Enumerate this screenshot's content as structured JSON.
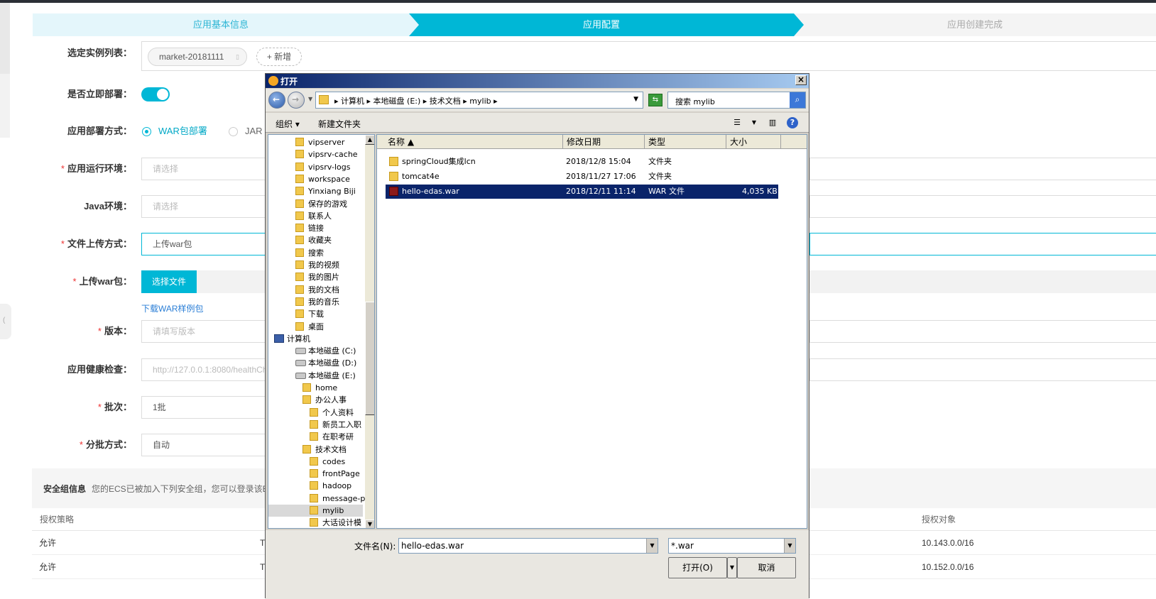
{
  "steps": [
    "应用基本信息",
    "应用配置",
    "应用创建完成"
  ],
  "form": {
    "instance_label": "选定实例列表：",
    "instance_tag": "market-20181111",
    "add_label": "+ 新增",
    "deploy_now_label": "是否立即部署：",
    "deploy_mode_label": "应用部署方式：",
    "deploy_war": "WAR包部署",
    "deploy_jar": "JAR",
    "runtime_label": "应用运行环境：",
    "runtime_placeholder": "请选择",
    "java_label": "Java环境：",
    "java_placeholder": "请选择",
    "upload_mode_label": "文件上传方式：",
    "upload_mode_value": "上传war包",
    "upload_war_label": "上传war包：",
    "choose_file": "选择文件",
    "download_sample": "下载WAR样例包",
    "version_label": "版本：",
    "version_placeholder": "请填写版本",
    "health_label": "应用健康检查：",
    "health_placeholder": "http://127.0.0.1:8080/healthCh",
    "batch_label": "批次：",
    "batch_value": "1批",
    "batch_mode_label": "分批方式：",
    "batch_mode_value": "自动"
  },
  "security": {
    "title": "安全组信息",
    "desc": "您的ECS已被加入下列安全组，您可以登录该E",
    "headers": [
      "授权策略",
      "授权对象"
    ],
    "rows": [
      {
        "policy": "允许",
        "mid": "T",
        "target": "10.143.0.0/16"
      },
      {
        "policy": "允许",
        "mid": "T",
        "target": "10.152.0.0/16"
      }
    ]
  },
  "dialog": {
    "title": "打开",
    "path": "▸ 计算机 ▸ 本地磁盘 (E:) ▸ 技术文档 ▸ mylib ▸",
    "search": "搜索 mylib",
    "organize": "组织 ▾",
    "new_folder": "新建文件夹",
    "tree": [
      {
        "label": "vipserver",
        "indent": 1
      },
      {
        "label": "vipsrv-cache",
        "indent": 1
      },
      {
        "label": "vipsrv-logs",
        "indent": 1
      },
      {
        "label": "workspace",
        "indent": 1
      },
      {
        "label": "Yinxiang Biji",
        "indent": 1
      },
      {
        "label": "保存的游戏",
        "indent": 1
      },
      {
        "label": "联系人",
        "indent": 1
      },
      {
        "label": "链接",
        "indent": 1
      },
      {
        "label": "收藏夹",
        "indent": 1
      },
      {
        "label": "搜索",
        "indent": 1
      },
      {
        "label": "我的视频",
        "indent": 1
      },
      {
        "label": "我的图片",
        "indent": 1
      },
      {
        "label": "我的文档",
        "indent": 1
      },
      {
        "label": "我的音乐",
        "indent": 1
      },
      {
        "label": "下载",
        "indent": 1
      },
      {
        "label": "桌面",
        "indent": 1
      },
      {
        "label": "计算机",
        "indent": 0
      },
      {
        "label": "本地磁盘 (C:)",
        "indent": 1
      },
      {
        "label": "本地磁盘 (D:)",
        "indent": 1
      },
      {
        "label": "本地磁盘 (E:)",
        "indent": 1
      },
      {
        "label": "home",
        "indent": 2
      },
      {
        "label": "办公人事",
        "indent": 2
      },
      {
        "label": "个人资料",
        "indent": 3
      },
      {
        "label": "新员工入职",
        "indent": 3
      },
      {
        "label": "在职考研",
        "indent": 3
      },
      {
        "label": "技术文档",
        "indent": 2
      },
      {
        "label": "codes",
        "indent": 3
      },
      {
        "label": "frontPage",
        "indent": 3
      },
      {
        "label": "hadoop",
        "indent": 3
      },
      {
        "label": "message-pu",
        "indent": 3
      },
      {
        "label": "mylib",
        "indent": 3
      },
      {
        "label": "大话设计模",
        "indent": 3
      }
    ],
    "columns": [
      "名称 ▲",
      "修改日期",
      "类型",
      "大小"
    ],
    "files": [
      {
        "name": "springCloud集成lcn",
        "date": "2018/12/8 15:04",
        "type": "文件夹",
        "size": ""
      },
      {
        "name": "tomcat4e",
        "date": "2018/11/27 17:06",
        "type": "文件夹",
        "size": ""
      },
      {
        "name": "hello-edas.war",
        "date": "2018/12/11 11:14",
        "type": "WAR 文件",
        "size": "4,035 KB"
      }
    ],
    "filename_label": "文件名(N):",
    "filename_value": "hello-edas.war",
    "filter_value": "*.war",
    "open_btn": "打开(O)",
    "cancel_btn": "取消"
  }
}
